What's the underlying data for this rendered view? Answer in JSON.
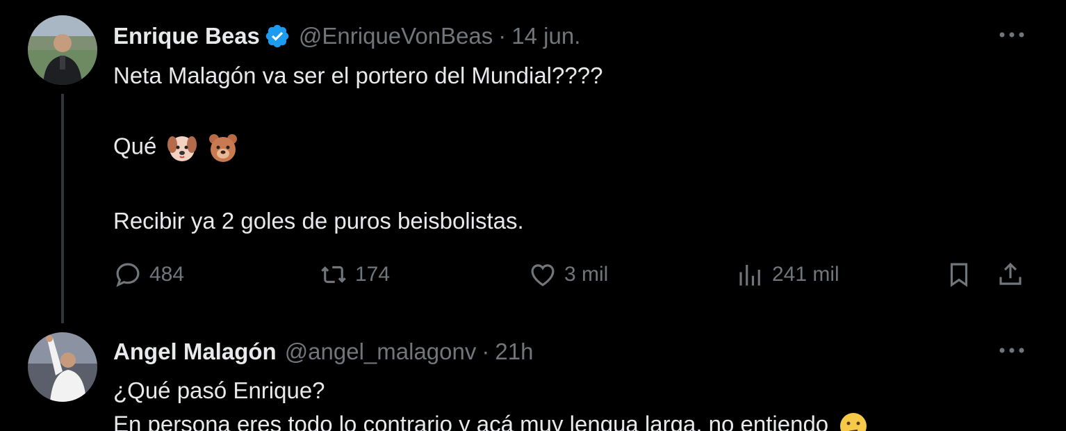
{
  "tweets": [
    {
      "name": "Enrique Beas",
      "handle": "@EnriqueVonBeas",
      "separator": "·",
      "time": "14 jun.",
      "lines": [
        "Neta Malagón va ser el portero del Mundial????",
        "Qué",
        "Recibir ya 2 goles de puros beisbolistas."
      ],
      "emojis": [
        "dog-face-emoji",
        "bear-face-emoji"
      ],
      "stats": {
        "replies": "484",
        "retweets": "174",
        "likes": "3 mil",
        "views": "241 mil"
      }
    },
    {
      "name": "Angel Malagón",
      "handle": "@angel_malagonv",
      "separator": "·",
      "time": "21h",
      "lines": [
        "¿Qué pasó Enrique?",
        "En persona eres todo lo contrario y acá muy lengua larga, no entiendo"
      ],
      "emojis": [
        "thinking-face-emoji"
      ]
    }
  ],
  "colors": {
    "background": "#000000",
    "text": "#e7e9ea",
    "secondary": "#71767b",
    "verified": "#1d9bf0",
    "thread_line": "#333639"
  }
}
